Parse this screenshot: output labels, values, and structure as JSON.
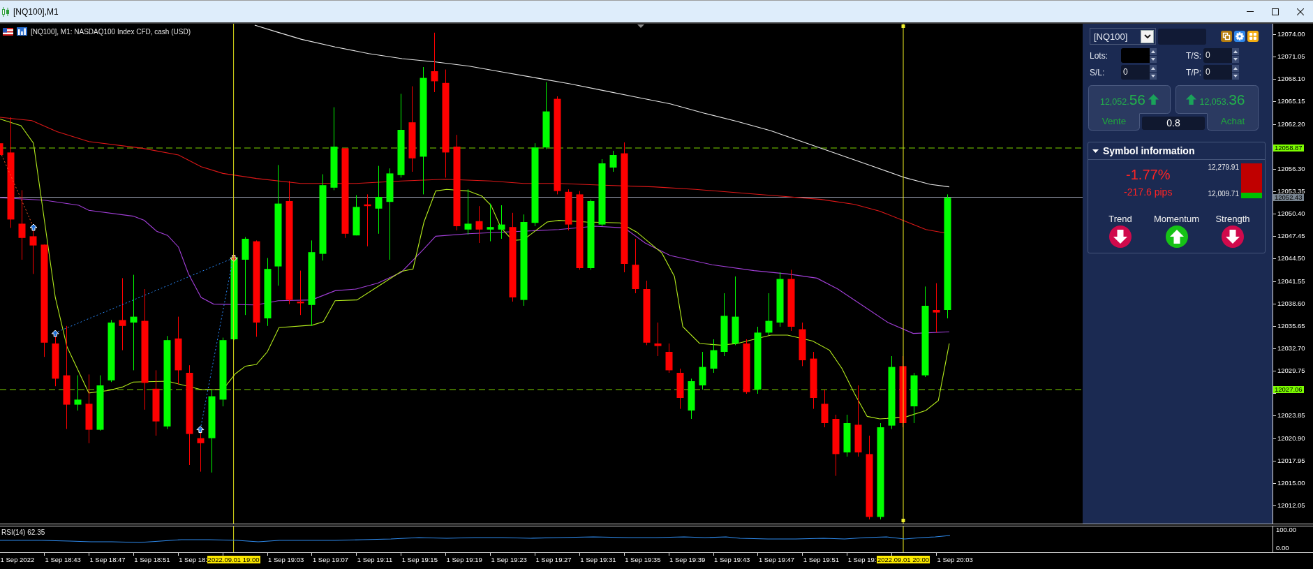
{
  "window": {
    "title": "[NQ100],M1"
  },
  "chart": {
    "caption": "[NQ100], M1: NASDAQ100 Index CFD, cash (USD)",
    "price_axis": [
      "12074.00",
      "12071.05",
      "12068.10",
      "12065.15",
      "12062.20",
      "12056.30",
      "12053.35",
      "12050.40",
      "12047.45",
      "12044.50",
      "12041.55",
      "12038.60",
      "12035.65",
      "12032.70",
      "12029.75",
      "12023.85",
      "12020.90",
      "12017.95",
      "12015.00",
      "12012.05"
    ],
    "price_levels": [
      {
        "label": "12058.87",
        "kind": "level"
      },
      {
        "label": "12052.43",
        "kind": "bid"
      },
      {
        "label": "12027.06",
        "kind": "level"
      }
    ],
    "time_axis": [
      "1 Sep 2022",
      "1 Sep 18:43",
      "1 Sep 18:47",
      "1 Sep 18:51",
      "1 Sep 18:",
      "1 Sep 19:03",
      "1 Sep 19:07",
      "1 Sep 19:11",
      "1 Sep 19:15",
      "1 Sep 19:19",
      "1 Sep 19:23",
      "1 Sep 19:27",
      "1 Sep 19:31",
      "1 Sep 19:35",
      "1 Sep 19:39",
      "1 Sep 19:43",
      "1 Sep 19:47",
      "1 Sep 19:51",
      "1 Sep 19:",
      "1 Sep 20:03"
    ],
    "time_markers": [
      {
        "label": "2022.09.01 19:00",
        "selected": false
      },
      {
        "label": "2022.09.01 20:00",
        "selected": true
      }
    ]
  },
  "rsi": {
    "label": "RSI(14) 62.35",
    "axis": [
      "100.00",
      "0.00"
    ]
  },
  "trade_panel": {
    "symbol": "[NQ100]",
    "fields": [
      {
        "label": "Lots:"
      },
      {
        "label": "T/S:",
        "value": "0"
      },
      {
        "label": "S/L:",
        "value": "0"
      },
      {
        "label": "T/P:",
        "value": "0"
      }
    ],
    "sell": {
      "price": "12,052.",
      "pips": "56",
      "up": true,
      "label": "Vente"
    },
    "buy": {
      "price": "12,053.",
      "pips": "36",
      "up": true,
      "label": "Achat"
    },
    "spread": "0.8"
  },
  "symbol_info": {
    "title": "Symbol information",
    "expanded": true,
    "change": "-1.77%",
    "change_pips": "-217.6 pips",
    "change_up": false,
    "range_high": "12,279.91",
    "range_low": "12,009.71",
    "level": 0.16,
    "signals": [
      {
        "label": "Trend",
        "up": false
      },
      {
        "label": "Momentum",
        "up": true
      },
      {
        "label": "Strength",
        "up": false
      }
    ]
  }
}
